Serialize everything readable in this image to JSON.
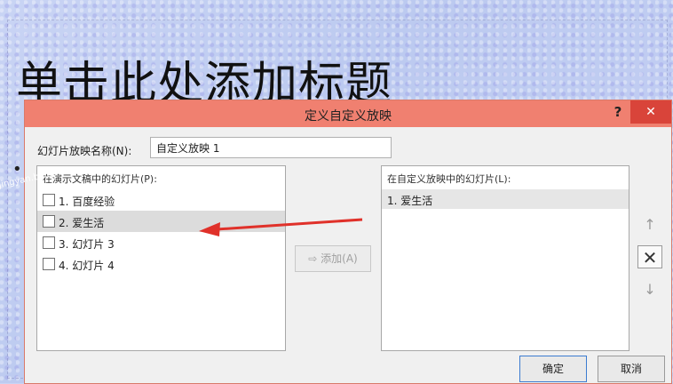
{
  "slide": {
    "title": "单击此处添加标题",
    "bullet": "•"
  },
  "dialog": {
    "title": "定义自定义放映",
    "help": "?",
    "close": "✕",
    "name_label": "幻灯片放映名称(N):",
    "name_value": "自定义放映 1",
    "left_header": "在演示文稿中的幻灯片(P):",
    "left_items": [
      {
        "label": "1. 百度经验",
        "selected": false
      },
      {
        "label": "2. 爱生活",
        "selected": true
      },
      {
        "label": "3. 幻灯片 3",
        "selected": false
      },
      {
        "label": "4. 幻灯片 4",
        "selected": false
      }
    ],
    "add_label": "⇨ 添加(A)",
    "right_header": "在自定义放映中的幻灯片(L):",
    "right_items": [
      "1. 爱生活"
    ],
    "up_icon": "↑",
    "remove_icon": "✕",
    "down_icon": "↓",
    "ok": "确定",
    "cancel": "取消"
  },
  "watermark": "jingyan.baidu"
}
